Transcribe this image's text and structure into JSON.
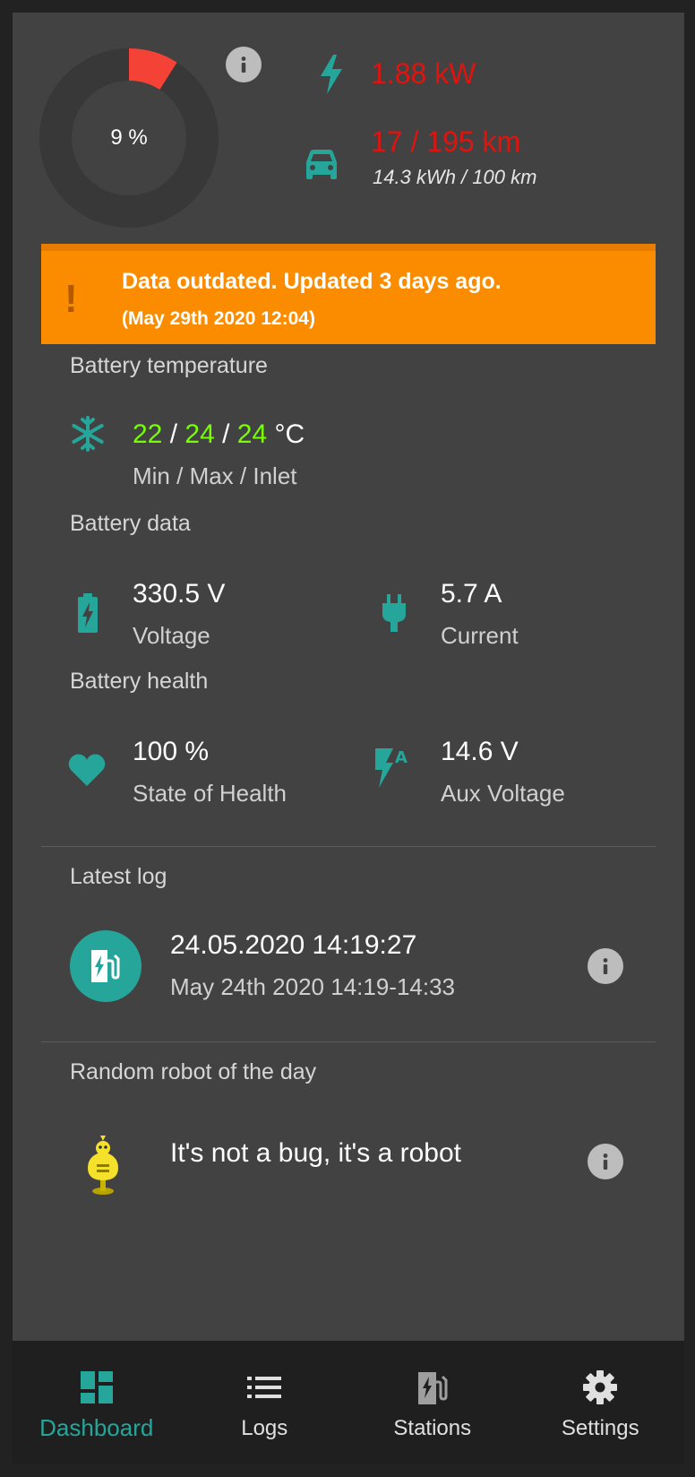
{
  "colors": {
    "accent": "#26a69a",
    "warning": "#fb8c00",
    "alert_red": "#e0140f",
    "green_value": "#76ff03",
    "gauge_fill": "#f44336"
  },
  "summary": {
    "soc_label": "9 %",
    "soc_percent": 9,
    "power": "1.88 kW",
    "range": "17 / 195 km",
    "consumption": "14.3 kWh / 100 km",
    "power_icon": "lightning-icon",
    "range_icon": "car-icon"
  },
  "warning": {
    "icon": "!",
    "title": "Data outdated. Updated 3 days ago.",
    "subtitle": "(May 29th 2020 12:04)"
  },
  "battery_temperature": {
    "title": "Battery temperature",
    "min": "22",
    "max": "24",
    "inlet": "24",
    "sep1": " / ",
    "sep2": " / ",
    "unit": " °C",
    "label": "Min / Max / Inlet",
    "icon": "snowflake-icon"
  },
  "battery_data": {
    "title": "Battery data",
    "voltage_value": "330.5 V",
    "voltage_label": "Voltage",
    "current_value": "5.7 A",
    "current_label": "Current",
    "voltage_icon": "battery-charging-icon",
    "current_icon": "plug-icon"
  },
  "battery_health": {
    "title": "Battery health",
    "soh_value": "100 %",
    "soh_label": "State of Health",
    "aux_value": "14.6 V",
    "aux_label": "Aux Voltage",
    "soh_icon": "heart-icon",
    "aux_icon": "aux-voltage-icon"
  },
  "latest_log": {
    "title": "Latest log",
    "datetime": "24.05.2020 14:19:27",
    "range": "May 24th 2020 14:19-14:33",
    "icon": "ev-station-icon"
  },
  "robot": {
    "title": "Random robot of the day",
    "text": "It's not a bug, it's a robot",
    "icon": "robot-icon"
  },
  "nav": {
    "items": [
      {
        "label": "Dashboard",
        "icon": "dashboard-icon",
        "active": true
      },
      {
        "label": "Logs",
        "icon": "list-icon",
        "active": false
      },
      {
        "label": "Stations",
        "icon": "ev-station-icon",
        "active": false
      },
      {
        "label": "Settings",
        "icon": "gear-icon",
        "active": false
      }
    ]
  }
}
